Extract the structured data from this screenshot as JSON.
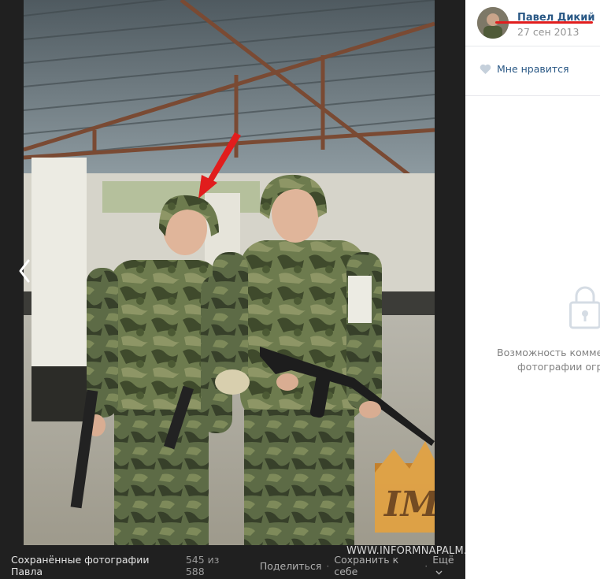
{
  "viewer": {
    "album_title": "Сохранённые фотографии Павла",
    "counter": "545 из 588",
    "actions": {
      "share": "Поделиться",
      "save": "Сохранить к себе",
      "more": "Ещё"
    },
    "watermark": "WWW.INFORMNAPALM.ORG",
    "watermark_logo": "IM",
    "prev_icon": "chevron-left-icon"
  },
  "sidebar": {
    "author_name": "Павел Дикий",
    "date": "27 сен 2013",
    "like_label": "Мне нравится",
    "restricted_line1": "Возможность коммен",
    "restricted_line2": "фотографии огр"
  },
  "colors": {
    "link": "#2a5885",
    "annotation_red": "#e11d1d",
    "viewer_bg": "#202020"
  }
}
